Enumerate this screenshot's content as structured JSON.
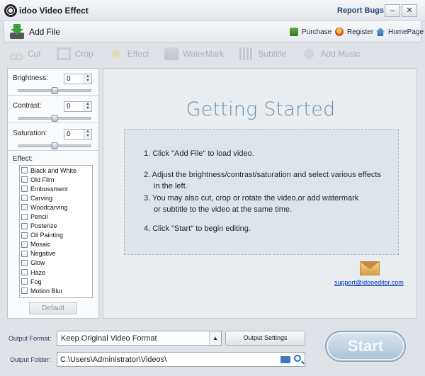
{
  "window": {
    "title": "idoo Video Effect",
    "report_bugs": "Report Bugs",
    "minimize": "–",
    "close": "✕"
  },
  "topbar": {
    "add_file": "Add File",
    "links": [
      {
        "label": "Purchase",
        "icon": "cart-icon"
      },
      {
        "label": "Register",
        "icon": "register-icon"
      },
      {
        "label": "HomePage",
        "icon": "home-icon"
      }
    ]
  },
  "toolbar": {
    "tools": [
      {
        "label": "Cut",
        "icon": "scissors-icon"
      },
      {
        "label": "Crop",
        "icon": "crop-icon"
      },
      {
        "label": "Effect",
        "icon": "effect-icon"
      },
      {
        "label": "WaterMark",
        "icon": "watermark-icon"
      },
      {
        "label": "Subtitle",
        "icon": "subtitle-icon"
      },
      {
        "label": "Add Music",
        "icon": "music-icon"
      }
    ]
  },
  "adjustments": {
    "brightness": {
      "label": "Brightness:",
      "value": "0",
      "level": 0.5
    },
    "contrast": {
      "label": "Contrast:",
      "value": "0",
      "level": 0.5
    },
    "saturation": {
      "label": "Saturation:",
      "value": "0",
      "level": 0.5
    }
  },
  "effects": {
    "label": "Effect:",
    "items": [
      "Black and White",
      "Old Film",
      "Embossment",
      "Carving",
      "Woodcarving",
      "Pencil",
      "Posterize",
      "Oil Painting",
      "Mosaic",
      "Negative",
      "Glow",
      "Haze",
      "Fog",
      "Motion Blur"
    ],
    "default_button": "Default"
  },
  "preview": {
    "title": "Getting Started",
    "steps": {
      "s1": "1. Click \"Add File\" to load video.",
      "s2": "2. Adjust the brightness/contrast/saturation and select various effects",
      "s2b": "in the left.",
      "s3": "3. You may also cut, crop or rotate the video,or add watermark",
      "s3b": "or subtitle to the video at the same time.",
      "s4": "4. Click \"Start\" to begin editing."
    },
    "support_email": "support@idooeditor.com"
  },
  "output": {
    "format_label": "Output Format:",
    "format_value": "Keep Original Video Format",
    "settings_button": "Output Settings",
    "folder_label": "Output Folder:",
    "folder_value": "C:\\Users\\Administrator\\Videos\\",
    "start_button": "Start"
  }
}
